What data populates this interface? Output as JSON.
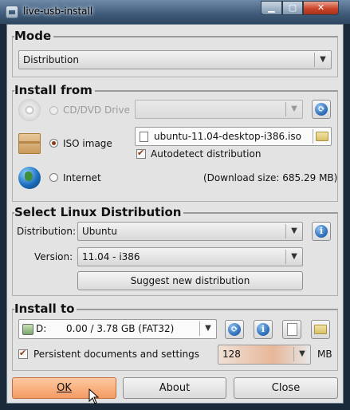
{
  "window": {
    "title": "live-usb-install"
  },
  "mode": {
    "heading": "Mode",
    "selected": "Distribution"
  },
  "install_from": {
    "heading": "Install from",
    "cd_label": "CD/DVD Drive",
    "iso_label": "ISO image",
    "iso_file": "ubuntu-11.04-desktop-i386.iso",
    "autodetect_label": "Autodetect distribution",
    "internet_label": "Internet",
    "download_size": "(Download size: 685.29 MB)"
  },
  "distribution": {
    "heading": "Select Linux Distribution",
    "dist_label": "Distribution:",
    "dist_value": "Ubuntu",
    "version_label": "Version:",
    "version_value": "11.04 - i386",
    "suggest_button": "Suggest new distribution"
  },
  "install_to": {
    "heading": "Install to",
    "drive_letter": "D:",
    "drive_info": "0.00 / 3.78 GB (FAT32)",
    "persistent_label": "Persistent documents and settings",
    "persistent_value": "128",
    "unit": "MB"
  },
  "buttons": {
    "ok": "OK",
    "about": "About",
    "close": "Close"
  },
  "icons": {
    "info": "i",
    "refresh": "refresh-icon",
    "folder": "folder-icon"
  },
  "colors": {
    "accent": "#f39b63",
    "link": "#2e6fb8"
  }
}
